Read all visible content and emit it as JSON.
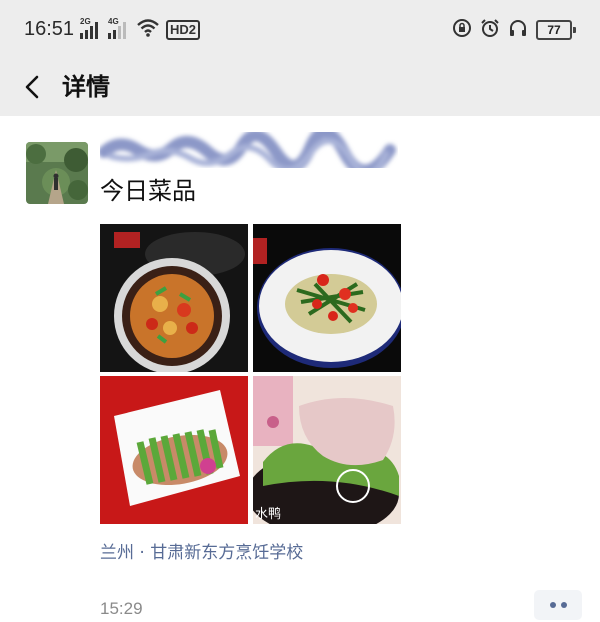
{
  "status_bar": {
    "time": "16:51",
    "signal1_label": "2G",
    "signal2_label": "4G",
    "network_label": "HD2",
    "battery_level": "77"
  },
  "nav": {
    "title": "详情"
  },
  "post": {
    "text": "今日菜品",
    "location": "兰州 · 甘肃新东方烹饪学校",
    "time": "15:29",
    "photo_watermark": "水鸭"
  },
  "colors": {
    "header_bg": "#ededed",
    "link_blue": "#576b95",
    "timestamp_gray": "#8a8a8a"
  },
  "icons": [
    "signal-icon",
    "wifi-icon",
    "lock-rotation-icon",
    "alarm-icon",
    "headphones-icon",
    "battery-icon",
    "back-icon",
    "more-icon"
  ]
}
